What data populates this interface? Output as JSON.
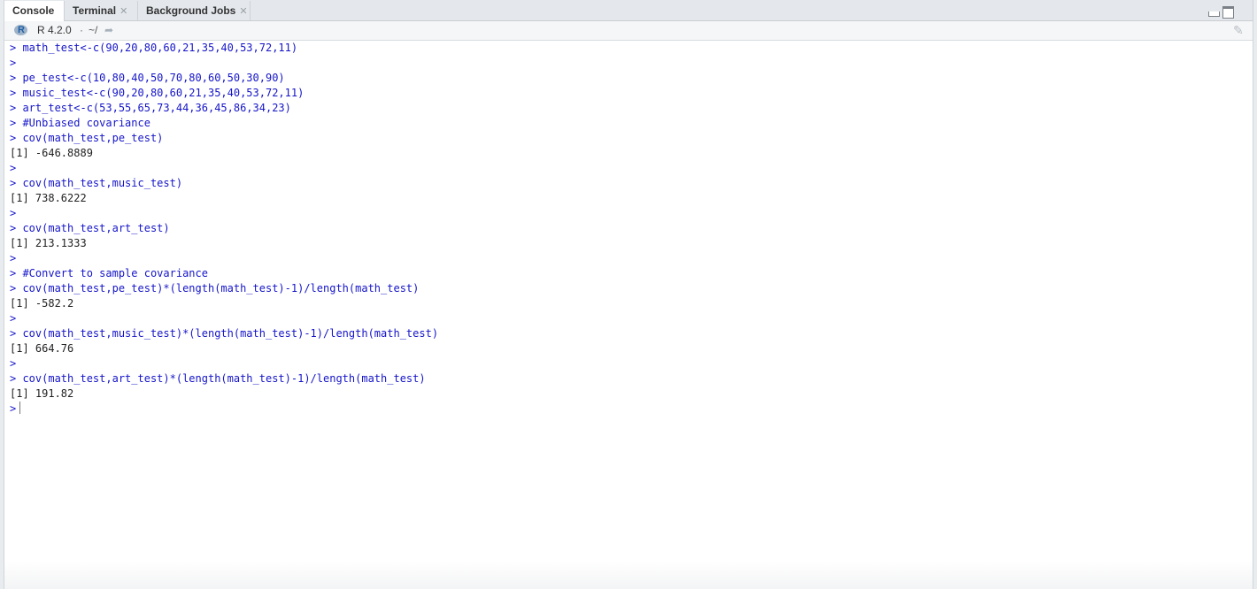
{
  "tabs": [
    {
      "label": "Console",
      "closable": false,
      "active": true
    },
    {
      "label": "Terminal",
      "closable": true,
      "active": false
    },
    {
      "label": "Background Jobs",
      "closable": true,
      "active": false
    }
  ],
  "toolbar": {
    "r_version": "R 4.2.0",
    "separator": "·",
    "path": "~/",
    "link_icon": "go-to-directory-icon",
    "clear_icon": "broom-clear-icon"
  },
  "console": {
    "lines": [
      {
        "kind": "cmd",
        "text": "> math_test<-c(90,20,80,60,21,35,40,53,72,11)"
      },
      {
        "kind": "cmd",
        "text": "> "
      },
      {
        "kind": "cmd",
        "text": "> pe_test<-c(10,80,40,50,70,80,60,50,30,90)"
      },
      {
        "kind": "cmd",
        "text": "> music_test<-c(90,20,80,60,21,35,40,53,72,11)"
      },
      {
        "kind": "cmd",
        "text": "> art_test<-c(53,55,65,73,44,36,45,86,34,23)"
      },
      {
        "kind": "cmd",
        "text": "> #Unbiased covariance"
      },
      {
        "kind": "cmd",
        "text": "> cov(math_test,pe_test)"
      },
      {
        "kind": "out",
        "text": "[1] -646.8889"
      },
      {
        "kind": "cmd",
        "text": "> "
      },
      {
        "kind": "cmd",
        "text": "> cov(math_test,music_test)"
      },
      {
        "kind": "out",
        "text": "[1] 738.6222"
      },
      {
        "kind": "cmd",
        "text": "> "
      },
      {
        "kind": "cmd",
        "text": "> cov(math_test,art_test)"
      },
      {
        "kind": "out",
        "text": "[1] 213.1333"
      },
      {
        "kind": "cmd",
        "text": "> "
      },
      {
        "kind": "cmd",
        "text": "> #Convert to sample covariance"
      },
      {
        "kind": "cmd",
        "text": "> cov(math_test,pe_test)*(length(math_test)-1)/length(math_test)"
      },
      {
        "kind": "out",
        "text": "[1] -582.2"
      },
      {
        "kind": "cmd",
        "text": "> "
      },
      {
        "kind": "cmd",
        "text": "> cov(math_test,music_test)*(length(math_test)-1)/length(math_test)"
      },
      {
        "kind": "out",
        "text": "[1] 664.76"
      },
      {
        "kind": "cmd",
        "text": "> "
      },
      {
        "kind": "cmd",
        "text": "> cov(math_test,art_test)*(length(math_test)-1)/length(math_test)"
      },
      {
        "kind": "out",
        "text": "[1] 191.82"
      }
    ],
    "prompt": ">"
  }
}
